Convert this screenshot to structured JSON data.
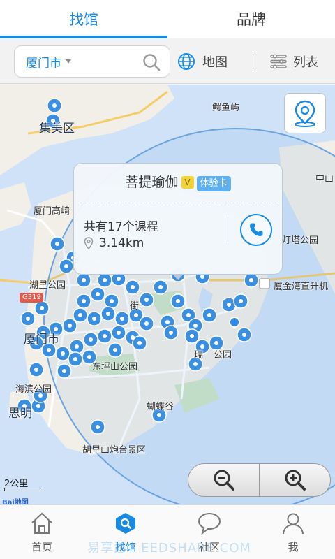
{
  "top_tabs": [
    {
      "label": "找馆",
      "active": true
    },
    {
      "label": "品牌",
      "active": false
    }
  ],
  "search": {
    "city": "厦门市",
    "map_label": "地图",
    "list_label": "列表"
  },
  "map": {
    "labels": {
      "jimei": "集美区",
      "eyuyu": "鳄鱼屿",
      "zhongshan": "中山",
      "xiamen_gaoqi": "厦门高崎",
      "dengta": "灯塔公园",
      "huli": "湖里公园",
      "g319": "G319",
      "jinwan": "厦金湾直升机",
      "jie": "街",
      "xiamen_city": "厦门市",
      "dongping": "东坪山公园",
      "rui_park": "瑞",
      "rui_park_suffix": "公园",
      "haibin": "海滨公园",
      "siming": "思明",
      "butterfly": "蝴蝶谷",
      "huli_shan": "胡里山炮台景区"
    },
    "popup": {
      "title": "菩提瑜伽",
      "v_badge": "V",
      "trial_badge": "体验卡",
      "course_count": "共有17个课程",
      "distance": "3.14km"
    },
    "scale": "2公里",
    "logo": "Bai地图"
  },
  "bottom_nav": [
    {
      "label": "首页",
      "icon": "home-icon",
      "active": false
    },
    {
      "label": "找馆",
      "icon": "search-icon",
      "active": true
    },
    {
      "label": "社区",
      "icon": "chat-icon",
      "active": false
    },
    {
      "label": "我",
      "icon": "user-icon",
      "active": false
    }
  ],
  "watermark": "易享游 · EEDSHARE.COM",
  "colors": {
    "accent": "#1a8ae0",
    "pin": "#3b8fe0",
    "land": "#f1efe8",
    "water": "#cfe2f7"
  }
}
